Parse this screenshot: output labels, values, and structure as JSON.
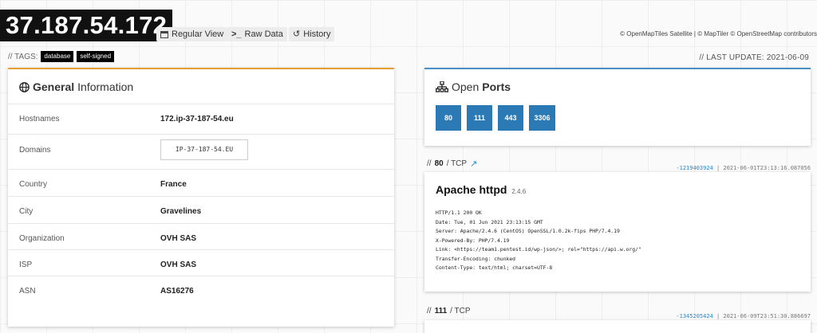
{
  "header": {
    "ip": "37.187.54.172",
    "views": [
      {
        "label": "Regular View",
        "icon": "table-icon"
      },
      {
        "label": "Raw Data",
        "icon": "terminal-icon"
      },
      {
        "label": "History",
        "icon": "history-icon"
      }
    ],
    "map_credit": "© OpenMapTiles Satellite | © MapTiler © OpenStreetMap contributors"
  },
  "tags": {
    "prefix": "// TAGS:",
    "items": [
      "database",
      "self-signed"
    ]
  },
  "last_update": "// LAST UPDATE: 2021-06-09",
  "general": {
    "title_bold": "General",
    "title_rest": "Information",
    "rows": [
      {
        "key": "Hostnames",
        "value": "172.ip-37-187-54.eu"
      },
      {
        "key": "Domains",
        "value": "IP-37-187-54.EU"
      },
      {
        "key": "Country",
        "value": "France"
      },
      {
        "key": "City",
        "value": "Gravelines"
      },
      {
        "key": "Organization",
        "value": "OVH SAS"
      },
      {
        "key": "ISP",
        "value": "OVH SAS"
      },
      {
        "key": "ASN",
        "value": "AS16276"
      }
    ]
  },
  "open_ports": {
    "title_rest": "Open",
    "title_bold": "Ports",
    "ports": [
      "80",
      "111",
      "443",
      "3306"
    ]
  },
  "services": [
    {
      "header_prefix": "//",
      "port": "80",
      "proto": "/ TCP",
      "hash": "-1219403924",
      "timestamp": "| 2021-06-01T23:13:16.087056",
      "product": "Apache httpd",
      "version": "2.4.6",
      "banner": [
        "HTTP/1.1 200 OK",
        "Date: Tue, 01 Jun 2021 23:13:15 GMT",
        "Server: Apache/2.4.6 (CentOS) OpenSSL/1.0.2k-fips PHP/7.4.19",
        "X-Powered-By: PHP/7.4.19",
        "Link: <https://team1.pentest.id/wp-json/>; rel=\"https://api.w.org/\"",
        "Transfer-Encoding: chunked",
        "Content-Type: text/html; charset=UTF-8"
      ]
    },
    {
      "header_prefix": "//",
      "port": "111",
      "proto": "/ TCP",
      "hash": "-1345205424",
      "timestamp": "| 2021-06-09T23:51:30.886697"
    }
  ],
  "colors": {
    "general_accent": "#e3a030",
    "ports_accent": "#4a90c2",
    "port_button": "#2b7ab6",
    "link": "#2b86c9"
  }
}
